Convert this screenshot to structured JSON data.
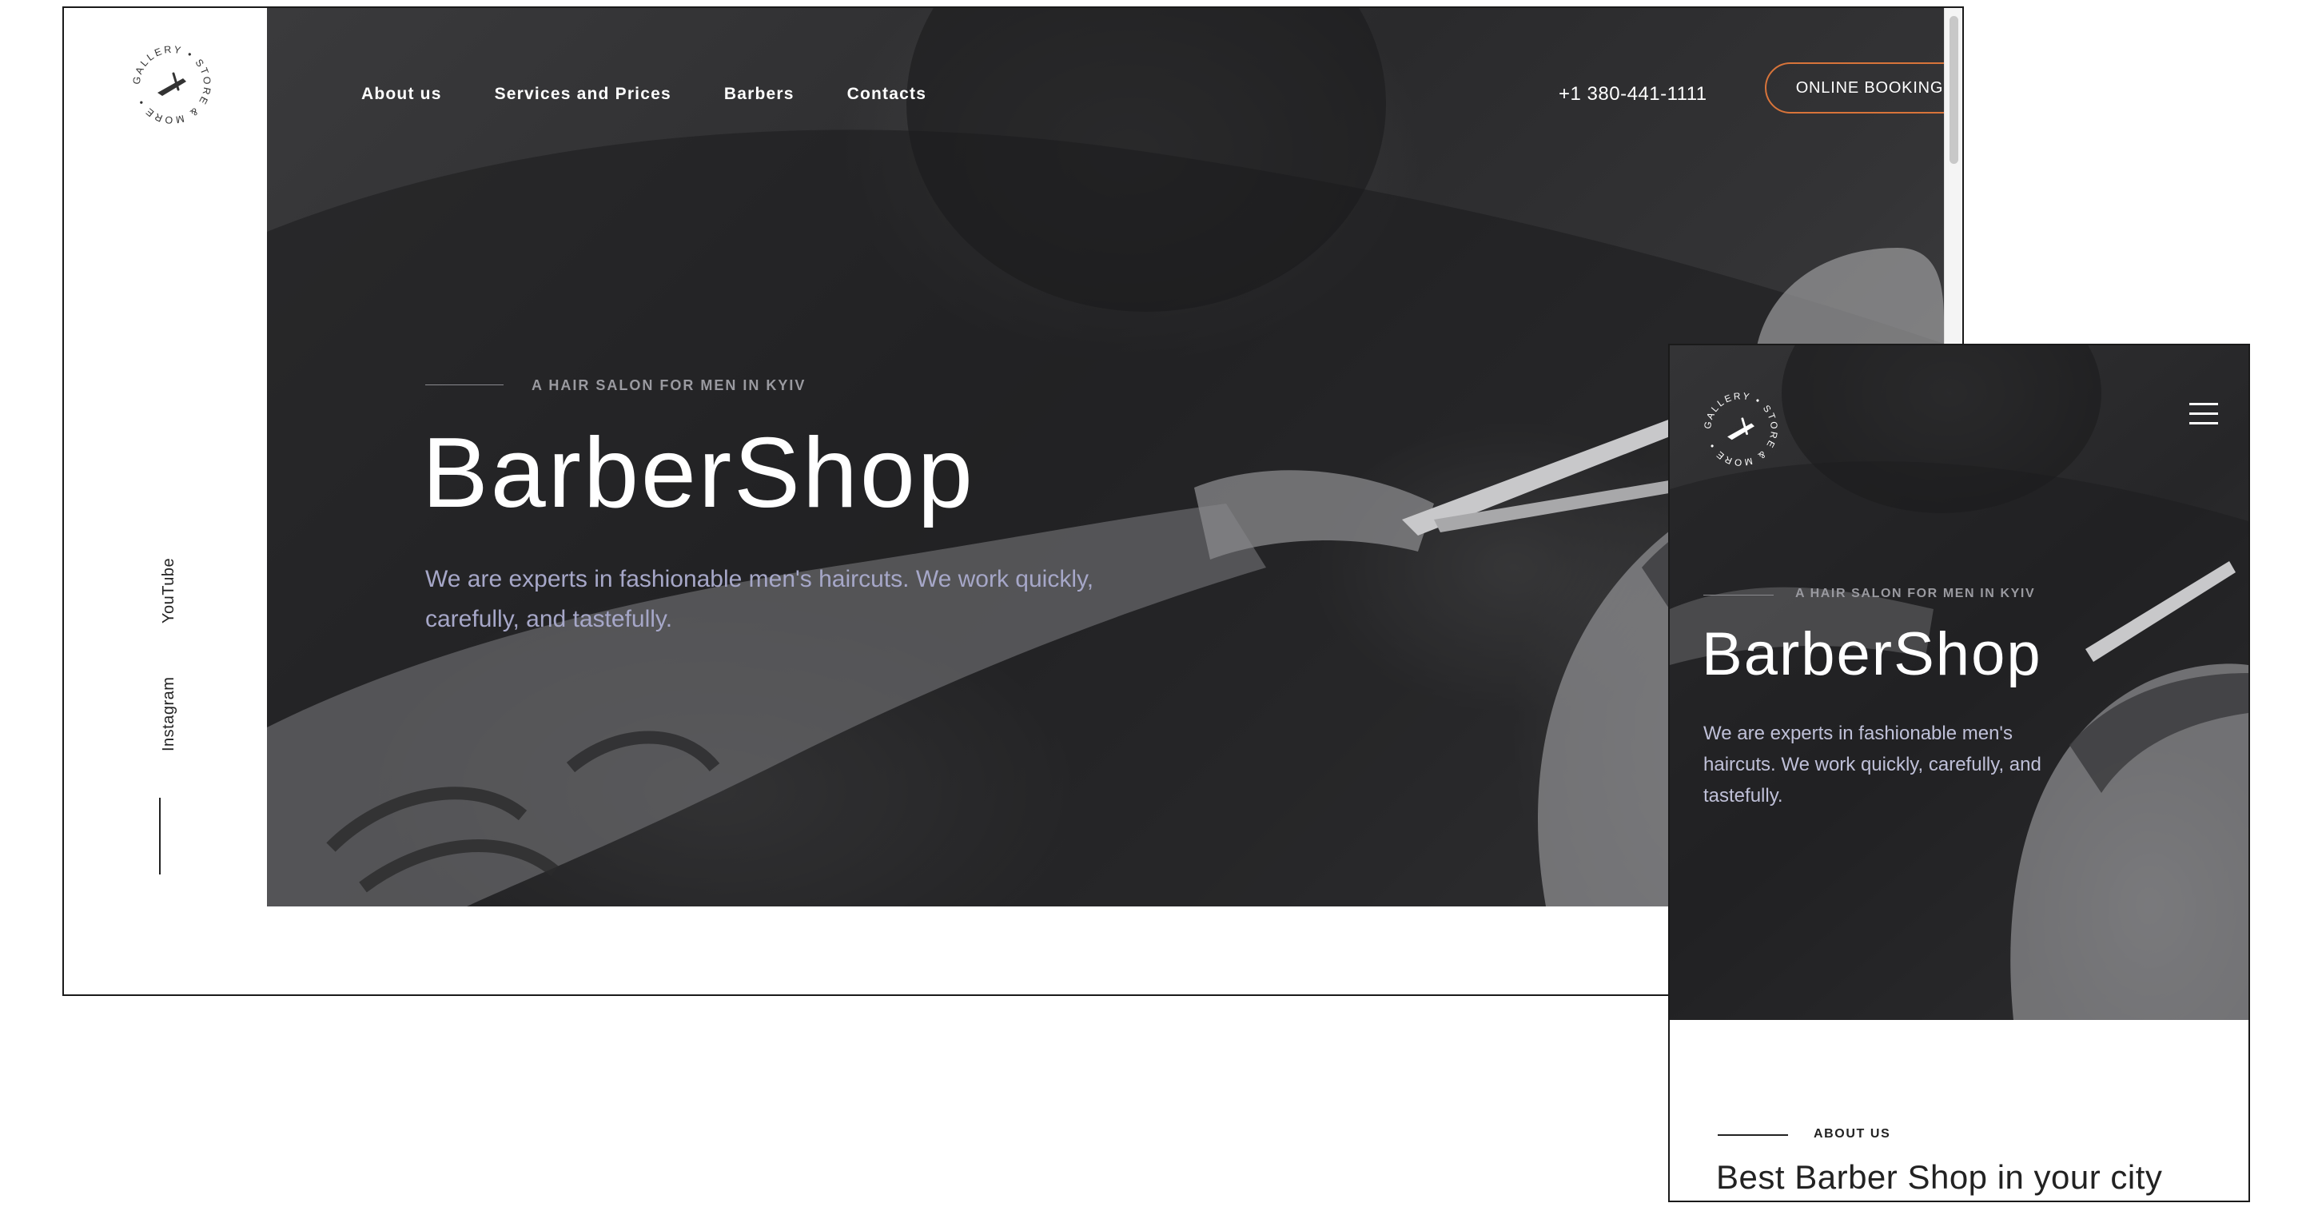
{
  "brand": {
    "logo_ring_text": "GALLERY • STORE & MORE •"
  },
  "desktop": {
    "nav": {
      "items": [
        "About us",
        "Services and Prices",
        "Barbers",
        "Contacts"
      ]
    },
    "phone": "+1 380-441-1111",
    "booking_label": "ONLINE BOOKING",
    "social": {
      "youtube": "YouTube",
      "instagram": "Instagram"
    },
    "hero": {
      "eyebrow": "A HAIR SALON FOR MEN IN KYIV",
      "title": "BarberShop",
      "text": "We are experts in fashionable men's haircuts. We work quickly, carefully, and tastefully."
    }
  },
  "mobile": {
    "hero": {
      "eyebrow": "A HAIR SALON FOR MEN IN KYIV",
      "title": "BarberShop",
      "text": "We are experts in fashionable men's haircuts. We work quickly, carefully, and tastefully."
    },
    "about": {
      "eyebrow": "ABOUT US",
      "heading": "Best Barber Shop in your city"
    }
  },
  "icons": {
    "menu": "hamburger-menu-icon",
    "logo": "straight-razor-logo-icon"
  },
  "colors": {
    "accent": "#d8743a",
    "hero_text": "#a6a7c8",
    "dark": "#2a2a2c"
  }
}
